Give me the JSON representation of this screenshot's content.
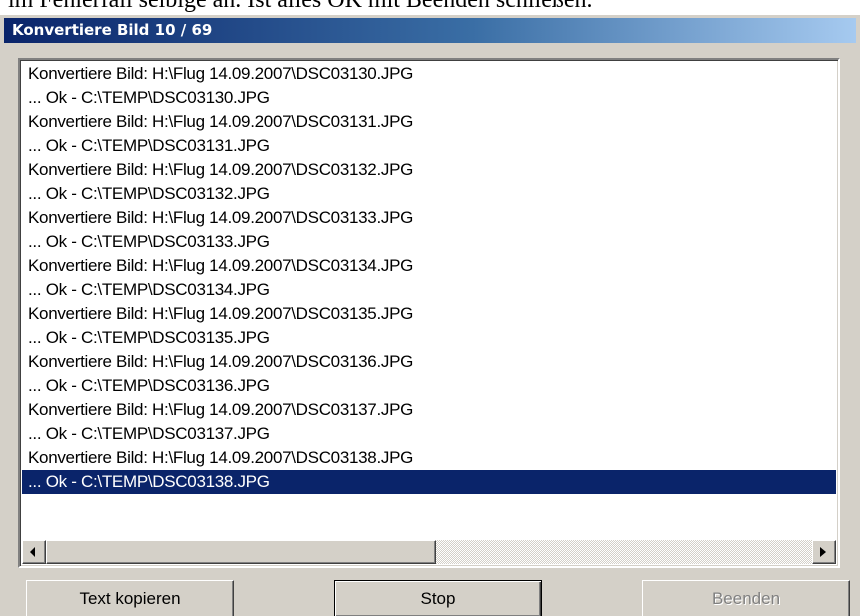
{
  "context_text": "im Fehlerfall selbige an. Ist alles OK mit Beenden schließen.",
  "window": {
    "title": "Konvertiere Bild 10 / 69"
  },
  "log": {
    "lines": [
      "Konvertiere Bild: H:\\Flug 14.09.2007\\DSC03130.JPG",
      "... Ok - C:\\TEMP\\DSC03130.JPG",
      "Konvertiere Bild: H:\\Flug 14.09.2007\\DSC03131.JPG",
      "... Ok - C:\\TEMP\\DSC03131.JPG",
      "Konvertiere Bild: H:\\Flug 14.09.2007\\DSC03132.JPG",
      "... Ok - C:\\TEMP\\DSC03132.JPG",
      "Konvertiere Bild: H:\\Flug 14.09.2007\\DSC03133.JPG",
      "... Ok - C:\\TEMP\\DSC03133.JPG",
      "Konvertiere Bild: H:\\Flug 14.09.2007\\DSC03134.JPG",
      "... Ok - C:\\TEMP\\DSC03134.JPG",
      "Konvertiere Bild: H:\\Flug 14.09.2007\\DSC03135.JPG",
      "... Ok - C:\\TEMP\\DSC03135.JPG",
      "Konvertiere Bild: H:\\Flug 14.09.2007\\DSC03136.JPG",
      "... Ok - C:\\TEMP\\DSC03136.JPG",
      "Konvertiere Bild: H:\\Flug 14.09.2007\\DSC03137.JPG",
      "... Ok - C:\\TEMP\\DSC03137.JPG",
      "Konvertiere Bild: H:\\Flug 14.09.2007\\DSC03138.JPG",
      "... Ok - C:\\TEMP\\DSC03138.JPG"
    ],
    "selected_index": 17,
    "scroll_position": 0
  },
  "buttons": {
    "copy_label": "Text kopieren",
    "stop_label": "Stop",
    "exit_label": "Beenden"
  },
  "colors": {
    "selection": "#0a246a",
    "dialog_face": "#d4d0c8",
    "title_start": "#0a246a",
    "title_end": "#a6caf0"
  }
}
